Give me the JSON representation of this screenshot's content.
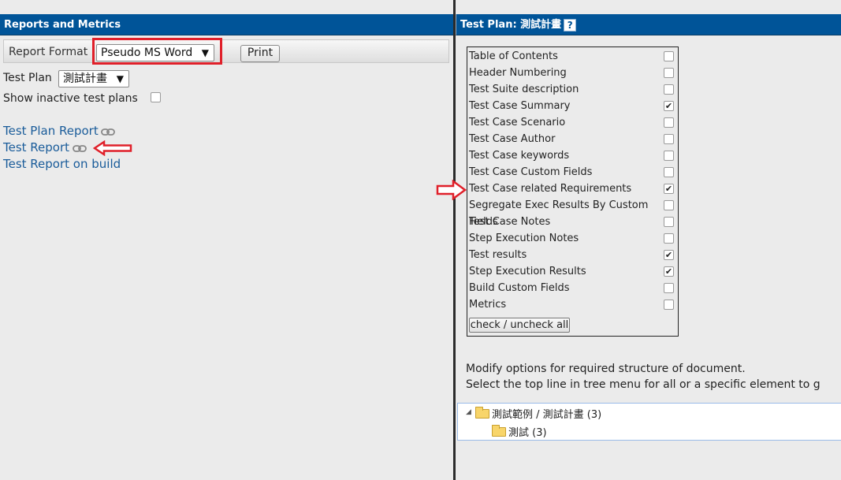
{
  "left_panel": {
    "header_title": "Reports and Metrics",
    "report_format_label": "Report Format",
    "report_format_value": "Pseudo MS Word",
    "print_label": "Print",
    "test_plan_label": "Test Plan",
    "test_plan_value": "測試計畫",
    "show_inactive_label": "Show inactive test plans",
    "links": [
      "Test Plan Report",
      "Test Report",
      "Test Report on build"
    ]
  },
  "right_panel": {
    "header_title": "Test Plan: 測試計畫",
    "help_icon_text": "?",
    "options": [
      {
        "label": "Table of Contents",
        "checked": false
      },
      {
        "label": "Header Numbering",
        "checked": false
      },
      {
        "label": "Test Suite description",
        "checked": false
      },
      {
        "label": "Test Case Summary",
        "checked": true
      },
      {
        "label": "Test Case Scenario",
        "checked": false
      },
      {
        "label": "Test Case Author",
        "checked": false
      },
      {
        "label": "Test Case keywords",
        "checked": false
      },
      {
        "label": "Test Case Custom Fields",
        "checked": false
      },
      {
        "label": "Test Case related Requirements",
        "checked": true
      },
      {
        "label": "Segregate Exec Results By Custom Fields",
        "checked": false
      },
      {
        "label": "Test Case Notes",
        "checked": false
      },
      {
        "label": "Step Execution Notes",
        "checked": false
      },
      {
        "label": "Test results",
        "checked": true
      },
      {
        "label": "Step Execution Results",
        "checked": true
      },
      {
        "label": "Build Custom Fields",
        "checked": false
      },
      {
        "label": "Metrics",
        "checked": false
      }
    ],
    "check_all_label": "check / uncheck all",
    "info_line1": "Modify options for required structure of document.",
    "info_line2": "Select the top line in tree menu for all or a specific element to g",
    "tree": {
      "root_label": "測試範例 / 測試計畫 (3)",
      "child_label": "測試 (3)"
    }
  },
  "colors": {
    "header_bg": "#005498",
    "link": "#1a5c9a",
    "highlight_red": "#e0202a"
  }
}
